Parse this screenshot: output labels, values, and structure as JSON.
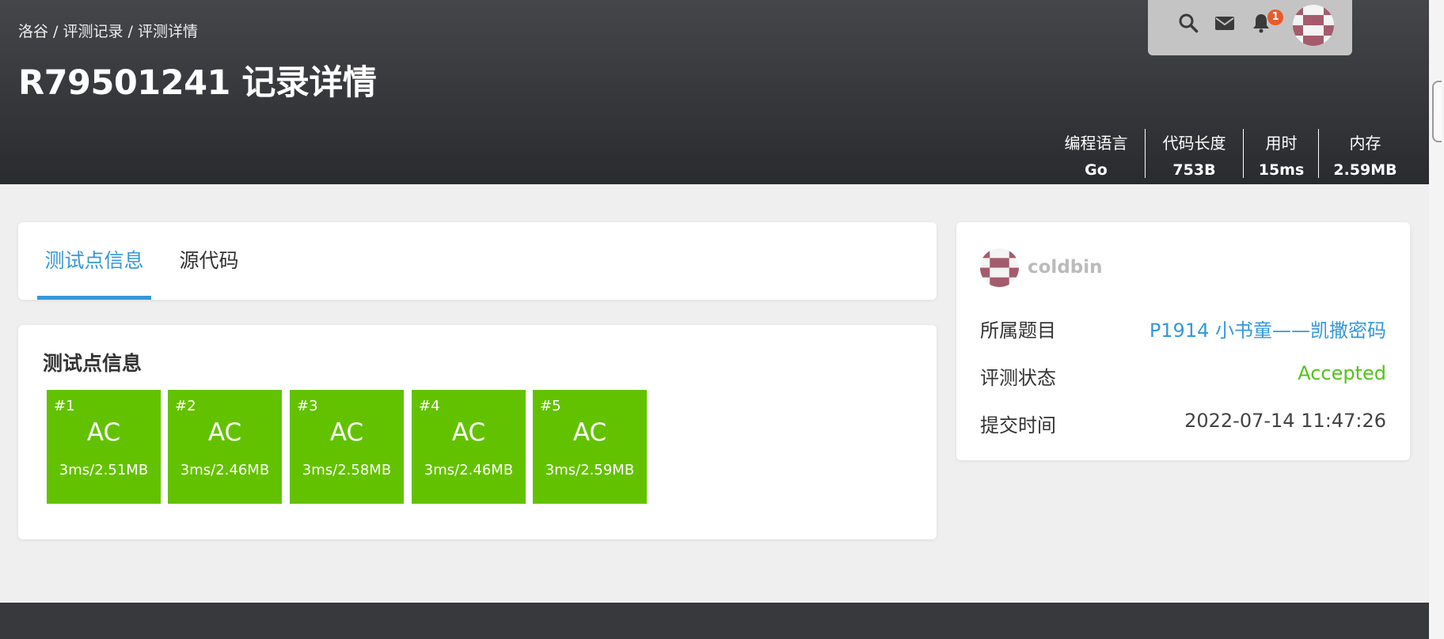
{
  "breadcrumb": {
    "items": [
      "洛谷",
      "评测记录",
      "评测详情"
    ],
    "separator": " / "
  },
  "title": "R79501241 记录详情",
  "user_menu": {
    "icons": [
      "search-icon",
      "mail-icon",
      "bell-icon"
    ],
    "notification_count": "1"
  },
  "stats": [
    {
      "label": "编程语言",
      "value": "Go"
    },
    {
      "label": "代码长度",
      "value": "753B"
    },
    {
      "label": "用时",
      "value": "15ms"
    },
    {
      "label": "内存",
      "value": "2.59MB"
    }
  ],
  "tabs": [
    {
      "label": "测试点信息",
      "active": true
    },
    {
      "label": "源代码",
      "active": false
    }
  ],
  "tests": {
    "title": "测试点信息",
    "cases": [
      {
        "id": "#1",
        "status": "AC",
        "stats": "3ms/2.51MB"
      },
      {
        "id": "#2",
        "status": "AC",
        "stats": "3ms/2.46MB"
      },
      {
        "id": "#3",
        "status": "AC",
        "stats": "3ms/2.58MB"
      },
      {
        "id": "#4",
        "status": "AC",
        "stats": "3ms/2.46MB"
      },
      {
        "id": "#5",
        "status": "AC",
        "stats": "3ms/2.59MB"
      }
    ],
    "color": "#63c200"
  },
  "info": {
    "username": "coldbin",
    "rows": [
      {
        "label": "所属题目",
        "value": "P1914 小书童——凯撒密码"
      },
      {
        "label": "评测状态",
        "value": "Accepted"
      },
      {
        "label": "提交时间",
        "value": "2022-07-14 11:47:26"
      }
    ]
  },
  "colors": {
    "header": "#2e2f33",
    "accent": "#3498db",
    "accepted": "#52c41a",
    "badge": "#e65b2a",
    "avatar": "#a45c6c"
  }
}
